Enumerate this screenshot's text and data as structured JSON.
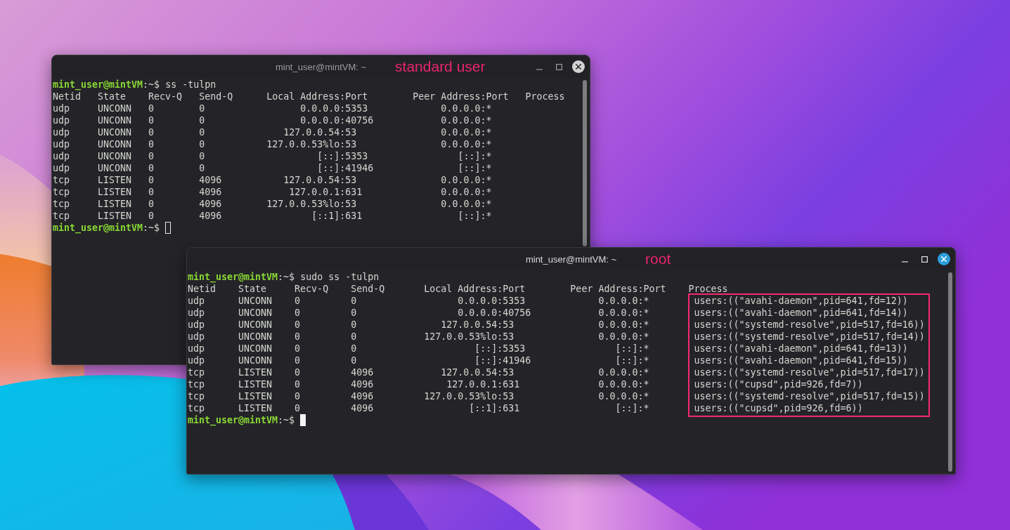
{
  "terminals": [
    {
      "title": "mint_user@mintVM: ~",
      "annotation": "standard user",
      "focused": false,
      "command_line": {
        "user_host": "mint_user@mintVM",
        "sign": ":~$",
        "command": "ss -tulpn"
      },
      "header": "Netid   State    Recv-Q   Send-Q      Local Address:Port        Peer Address:Port   Process",
      "rows": [
        {
          "text": "udp     UNCONN   0        0                 0.0.0.0:5353             0.0.0.0:*"
        },
        {
          "text": "udp     UNCONN   0        0                 0.0.0.0:40756            0.0.0.0:*"
        },
        {
          "text": "udp     UNCONN   0        0              127.0.0.54:53               0.0.0.0:*"
        },
        {
          "text": "udp     UNCONN   0        0           127.0.0.53%lo:53               0.0.0.0:*"
        },
        {
          "text": "udp     UNCONN   0        0                    [::]:5353                [::]:*"
        },
        {
          "text": "udp     UNCONN   0        0                    [::]:41946               [::]:*"
        },
        {
          "text": "tcp     LISTEN   0        4096           127.0.0.54:53               0.0.0.0:*"
        },
        {
          "text": "tcp     LISTEN   0        4096            127.0.0.1:631              0.0.0.0:*"
        },
        {
          "text": "tcp     LISTEN   0        4096        127.0.0.53%lo:53               0.0.0.0:*"
        },
        {
          "text": "tcp     LISTEN   0        4096                [::1]:631                 [::]:*"
        }
      ],
      "prompt": {
        "user_host": "mint_user@mintVM",
        "sign": ":~$"
      }
    },
    {
      "title": "mint_user@mintVM: ~",
      "annotation": "root",
      "focused": true,
      "command_line": {
        "user_host": "mint_user@mintVM",
        "sign": ":~$",
        "command": "sudo ss -tulpn"
      },
      "header": "Netid    State     Recv-Q    Send-Q       Local Address:Port        Peer Address:Port    Process",
      "process_highlight": true,
      "rows": [
        {
          "text": "udp      UNCONN    0         0                  0.0.0.0:5353             0.0.0.0:*",
          "process": "users:((\"avahi-daemon\",pid=641,fd=12))"
        },
        {
          "text": "udp      UNCONN    0         0                  0.0.0.0:40756            0.0.0.0:*",
          "process": "users:((\"avahi-daemon\",pid=641,fd=14))"
        },
        {
          "text": "udp      UNCONN    0         0               127.0.0.54:53               0.0.0.0:*",
          "process": "users:((\"systemd-resolve\",pid=517,fd=16))"
        },
        {
          "text": "udp      UNCONN    0         0            127.0.0.53%lo:53               0.0.0.0:*",
          "process": "users:((\"systemd-resolve\",pid=517,fd=14))"
        },
        {
          "text": "udp      UNCONN    0         0                     [::]:5353                [::]:*",
          "process": "users:((\"avahi-daemon\",pid=641,fd=13))"
        },
        {
          "text": "udp      UNCONN    0         0                     [::]:41946               [::]:*",
          "process": "users:((\"avahi-daemon\",pid=641,fd=15))"
        },
        {
          "text": "tcp      LISTEN    0         4096            127.0.0.54:53               0.0.0.0:*",
          "process": "users:((\"systemd-resolve\",pid=517,fd=17))"
        },
        {
          "text": "tcp      LISTEN    0         4096             127.0.0.1:631              0.0.0.0:*",
          "process": "users:((\"cupsd\",pid=926,fd=7))"
        },
        {
          "text": "tcp      LISTEN    0         4096         127.0.0.53%lo:53               0.0.0.0:*",
          "process": "users:((\"systemd-resolve\",pid=517,fd=15))"
        },
        {
          "text": "tcp      LISTEN    0         4096                 [::1]:631                 [::]:*",
          "process": "users:((\"cupsd\",pid=926,fd=6))"
        }
      ],
      "prompt": {
        "user_host": "mint_user@mintVM",
        "sign": ":~$"
      }
    }
  ]
}
